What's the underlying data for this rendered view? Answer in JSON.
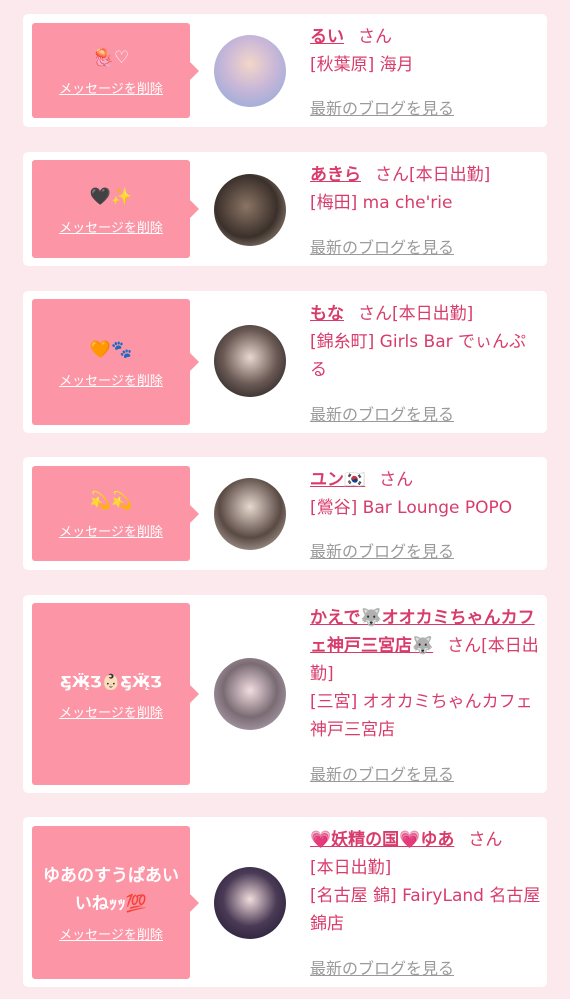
{
  "delete_label": "メッセージを削除",
  "blog_label": "最新のブログを見る",
  "cards": [
    {
      "message": "🪼♡",
      "name": "るい",
      "honorific": "さん",
      "status": "",
      "shop": "[秋葉原] 海月"
    },
    {
      "message": "🖤✨",
      "name": "あきら",
      "honorific": "さん",
      "status": "[本日出勤]",
      "shop": "[梅田] ma che'rie"
    },
    {
      "message": "🧡🐾",
      "name": "もな",
      "honorific": "さん",
      "status": "[本日出勤]",
      "shop": "[錦糸町] Girls Bar でぃんぷる"
    },
    {
      "message": "💫💫",
      "name": "ユン🇰🇷",
      "honorific": "さん",
      "status": "",
      "shop": "[鶯谷] Bar Lounge POPO"
    },
    {
      "message": "Ƹ̵̡Ӝ̵̨̄Ʒ👶🏻Ƹ̵̡Ӝ̵̨̄Ʒ",
      "name": "かえで🐺オオカミちゃんカフェ神戸三宮店🐺",
      "honorific": "さん",
      "status": "[本日出勤]",
      "shop": "[三宮] オオカミちゃんカフェ神戸三宮店"
    },
    {
      "message": "ゆあのすうぱあいいねｯｯ💯",
      "name": "💗妖精の国💗ゆあ",
      "honorific": "さん",
      "status": "[本日出勤]",
      "shop": "[名古屋 錦] FairyLand 名古屋錦店"
    }
  ],
  "colors": {
    "accent": "#d83c6c",
    "bubble": "#fc95a6",
    "page_bg": "#fbe9ee",
    "link_gray": "#9a9a9a"
  }
}
